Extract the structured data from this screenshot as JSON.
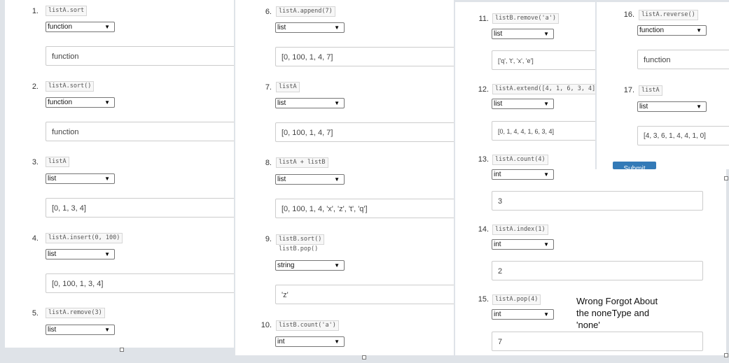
{
  "q1": {
    "num": "1.",
    "code": "listA.sort",
    "type": "function",
    "answer": "function"
  },
  "q2": {
    "num": "2.",
    "code": "listA.sort()",
    "type": "function",
    "answer": "function"
  },
  "q3": {
    "num": "3.",
    "code": "listA",
    "type": "list",
    "answer": "[0, 1, 3, 4]"
  },
  "q4": {
    "num": "4.",
    "code": "listA.insert(0, 100)",
    "type": "list",
    "answer": "[0, 100, 1, 3, 4]"
  },
  "q5": {
    "num": "5.",
    "code": "listA.remove(3)",
    "type": "list"
  },
  "q6": {
    "num": "6.",
    "code": "listA.append(7)",
    "type": "list",
    "answer": "[0, 100, 1, 4, 7]"
  },
  "q7": {
    "num": "7.",
    "code": "listA",
    "type": "list",
    "answer": "[0, 100, 1, 4, 7]"
  },
  "q8": {
    "num": "8.",
    "code": "listA + listB",
    "type": "list",
    "answer": "[0, 100, 1, 4, 'x', 'z', 't', 'q']"
  },
  "q9": {
    "num": "9.",
    "code1": "listB.sort()",
    "code2": "listB.pop()",
    "type": "string",
    "answer": "'z'"
  },
  "q10": {
    "num": "10.",
    "code": "listB.count('a')",
    "type": "int"
  },
  "q11": {
    "num": "11.",
    "code": "listB.remove('a')",
    "type": "list",
    "answer": "['q', 't', 'x', 'e']"
  },
  "q12": {
    "num": "12.",
    "code": "listA.extend([4, 1, 6, 3, 4])",
    "type": "list",
    "answer": "[0, 1, 4, 4, 1, 6, 3, 4]"
  },
  "q13": {
    "num": "13.",
    "code": "listA.count(4)",
    "type": "int",
    "answer": "3"
  },
  "q14": {
    "num": "14.",
    "code": "listA.index(1)",
    "type": "int",
    "answer": "2"
  },
  "q15": {
    "num": "15.",
    "code": "listA.pop(4)",
    "type": "int",
    "answer": "7"
  },
  "q16": {
    "num": "16.",
    "code": "listA.reverse()",
    "type": "function",
    "answer": "function"
  },
  "q17": {
    "num": "17.",
    "code": "listA",
    "type": "list",
    "answer": "[4, 3, 6, 1, 4, 4, 1, 0]"
  },
  "submit_label": "Submit",
  "note": {
    "line1": "Wrong Forgot About",
    "line2": "the noneType and",
    "line3": "'none'"
  },
  "colors": {
    "submit": "#337ab7",
    "panel": "#ffffff",
    "background": "#dfe3e8"
  }
}
